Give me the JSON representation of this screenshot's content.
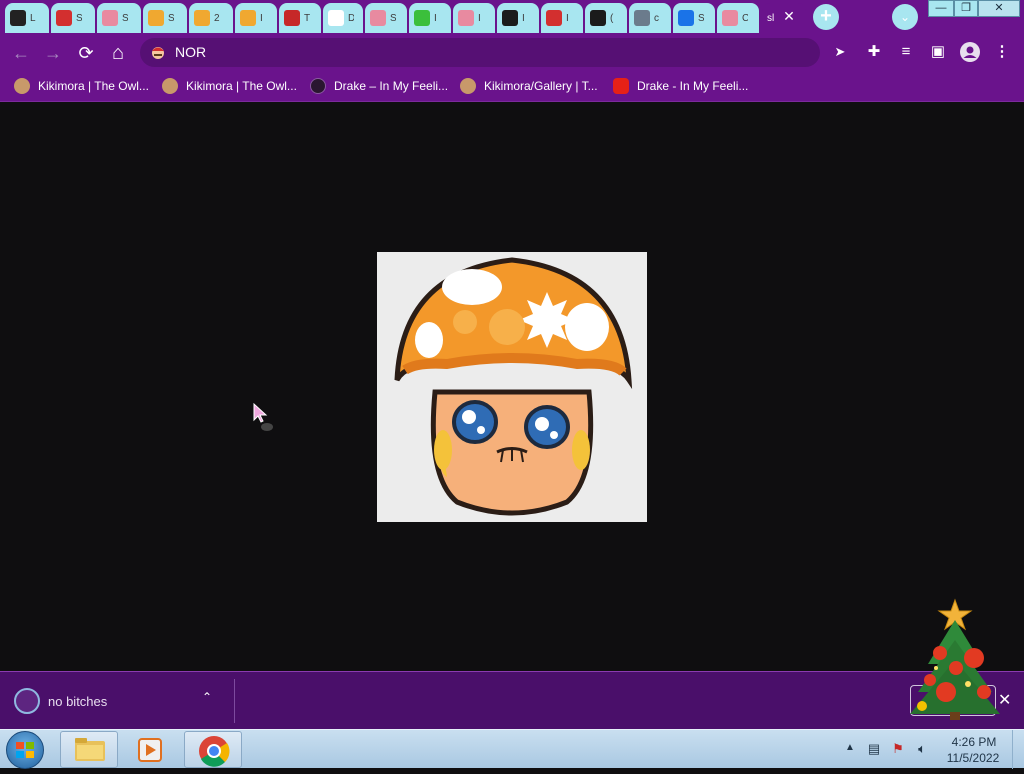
{
  "tabs": [
    {
      "label": "L",
      "icon": "game-icon",
      "color": "#222222"
    },
    {
      "label": "S",
      "icon": "mario-icon",
      "color": "#d32f2f"
    },
    {
      "label": "S",
      "icon": "store-icon",
      "color": "#e88aa0"
    },
    {
      "label": "S",
      "icon": "mushroom-icon",
      "color": "#f0a830"
    },
    {
      "label": "2",
      "icon": "mushroom-icon",
      "color": "#f0a830"
    },
    {
      "label": "I",
      "icon": "mushroom-icon",
      "color": "#f0a830"
    },
    {
      "label": "T",
      "icon": "video-icon",
      "color": "#c62828"
    },
    {
      "label": "D",
      "icon": "speaker-icon",
      "color": "#ffffff"
    },
    {
      "label": "S",
      "icon": "store-icon",
      "color": "#e88aa0"
    },
    {
      "label": "I",
      "icon": "frog-icon",
      "color": "#3bbf3b"
    },
    {
      "label": "I",
      "icon": "store-icon",
      "color": "#e88aa0"
    },
    {
      "label": "I",
      "icon": "terminal-icon",
      "color": "#1b1b1b"
    },
    {
      "label": "I",
      "icon": "mario-icon",
      "color": "#d32f2f"
    },
    {
      "label": "(",
      "icon": "power-icon",
      "color": "#1b1b1b"
    },
    {
      "label": "c",
      "icon": "globe-icon",
      "color": "#6b7b8c"
    },
    {
      "label": "S",
      "icon": "gear-icon",
      "color": "#1a73e8"
    },
    {
      "label": "C",
      "icon": "store-icon",
      "color": "#e88aa0"
    }
  ],
  "active_tab": {
    "label": "sl",
    "close": "✕"
  },
  "new_tab": "+",
  "tab_search": "⌄",
  "window_buttons": {
    "minimize": "—",
    "restore": "❐",
    "close": "✕"
  },
  "toolbar": {
    "back": "←",
    "forward": "→",
    "reload": "⟳",
    "home": "⌂",
    "url": "NOR",
    "site_icon": "mario-icon",
    "icons": [
      "cursor-extension-icon",
      "puzzle-icon",
      "media-queue-icon",
      "side-panel-icon",
      "profile-icon",
      "menu-icon"
    ]
  },
  "bookmarks": [
    {
      "label": "Kikimora | The Owl...",
      "icon": "owl-icon",
      "color": "#c8996a"
    },
    {
      "label": "Kikimora | The Owl...",
      "icon": "owl-icon",
      "color": "#c8996a"
    },
    {
      "label": "Drake – In My Feeli...",
      "icon": "moon-icon",
      "color": "#2a1630"
    },
    {
      "label": "Kikimora/Gallery | T...",
      "icon": "owl-icon",
      "color": "#c8996a"
    },
    {
      "label": "Drake - In My Feeli...",
      "icon": "youtube-icon",
      "color": "#e62117"
    }
  ],
  "download": {
    "filename": "no bitches",
    "caret": "⌃",
    "close": "✕"
  },
  "taskbar": {
    "time": "4:26 PM",
    "date": "11/5/2022"
  },
  "colors": {
    "chrome_purple": "#6a138c",
    "tab_cyan": "#a8e6f0",
    "content_bg": "#0f0e10"
  }
}
